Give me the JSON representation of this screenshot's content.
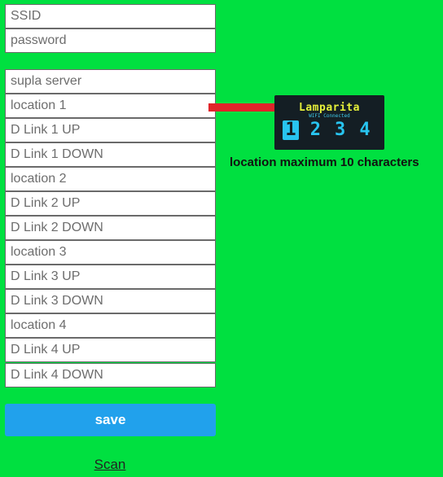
{
  "wifi": {
    "ssid_placeholder": "SSID",
    "password_placeholder": "password"
  },
  "config": {
    "fields": [
      "supla server",
      "location 1",
      "D Link 1 UP",
      "D Link 1 DOWN",
      "location 2",
      "D Link 2 UP",
      "D Link 2 DOWN",
      "location 3",
      "D Link 3 UP",
      "D Link 3 DOWN",
      "location 4",
      "D Link 4 UP",
      "D Link 4 DOWN"
    ]
  },
  "actions": {
    "save_label": "save",
    "scan_label": "Scan"
  },
  "illustration": {
    "display_title": "Lamparita",
    "display_subtitle": "WIFI Connected",
    "channels": [
      "1",
      "2",
      "3",
      "4"
    ],
    "note": "location maximum 10 characters",
    "arrow_color": "#e0242a"
  },
  "colors": {
    "background": "#00e040",
    "save_button": "#21a1ec"
  }
}
